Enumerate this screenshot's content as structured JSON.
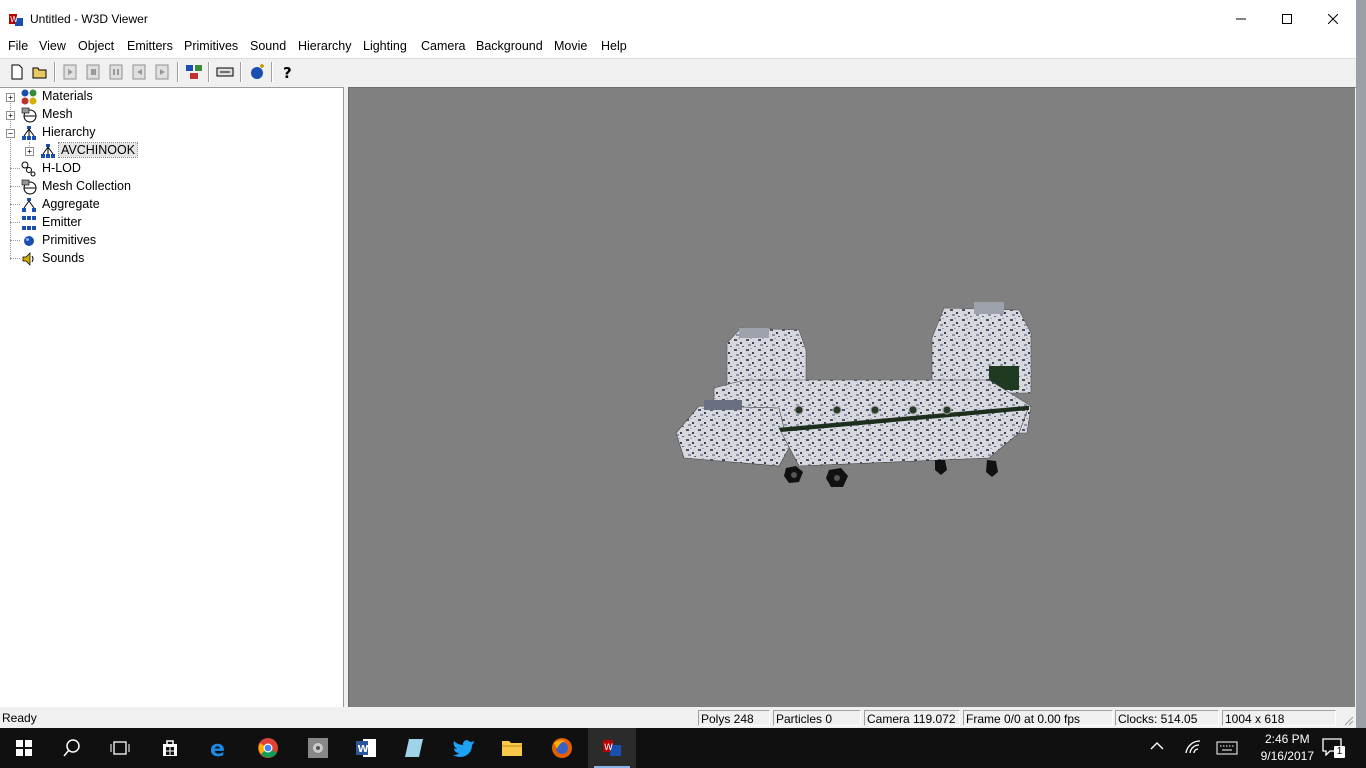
{
  "window": {
    "title": "Untitled - W3D Viewer"
  },
  "menu": [
    "File",
    "View",
    "Object",
    "Emitters",
    "Primitives",
    "Sound",
    "Hierarchy",
    "Lighting",
    "Camera",
    "Background",
    "Movie",
    "Help"
  ],
  "toolbar": {
    "icons": [
      "new-file-icon",
      "open-folder-icon",
      "anim-play-icon",
      "anim-stop-icon",
      "anim-pause-icon",
      "anim-step-back-icon",
      "anim-step-forward-icon",
      "object-tree-icon",
      "keyboard-icon",
      "add-object-icon",
      "help-icon"
    ]
  },
  "tree": {
    "items": [
      {
        "label": "Materials",
        "expander": "+",
        "icon": "materials-icon"
      },
      {
        "label": "Mesh",
        "expander": "+",
        "icon": "mesh-icon"
      },
      {
        "label": "Hierarchy",
        "expander": "−",
        "icon": "hierarchy-icon"
      },
      {
        "label": "AVCHINOOK",
        "expander": "+",
        "icon": "hierarchy-icon"
      },
      {
        "label": "H-LOD",
        "expander": "",
        "icon": "hlod-icon"
      },
      {
        "label": "Mesh Collection",
        "expander": "",
        "icon": "mesh-collection-icon"
      },
      {
        "label": "Aggregate",
        "expander": "",
        "icon": "aggregate-icon"
      },
      {
        "label": "Emitter",
        "expander": "",
        "icon": "emitter-icon"
      },
      {
        "label": "Primitives",
        "expander": "",
        "icon": "primitives-icon"
      },
      {
        "label": "Sounds",
        "expander": "",
        "icon": "sound-icon"
      }
    ],
    "selected": "AVCHINOOK"
  },
  "status": {
    "ready": "Ready",
    "polys": "Polys 248",
    "particles": "Particles 0",
    "camera": "Camera 119.072",
    "frame": "Frame 0/0 at 0.00 fps",
    "clocks": "Clocks: 514.05",
    "resolution": "1004 x 618"
  },
  "taskbar": {
    "time": "2:46 PM",
    "date": "9/16/2017",
    "notification_count": "1",
    "apps": [
      "start-icon",
      "search-icon",
      "task-view-icon",
      "store-icon",
      "edge-icon",
      "chrome-icon",
      "app-icon",
      "word-icon",
      "app-icon",
      "twitter-icon",
      "file-explorer-icon",
      "firefox-icon",
      "w3d-viewer-icon"
    ]
  },
  "colors": {
    "viewport_bg": "#808080",
    "taskbar_bg": "#101010"
  }
}
